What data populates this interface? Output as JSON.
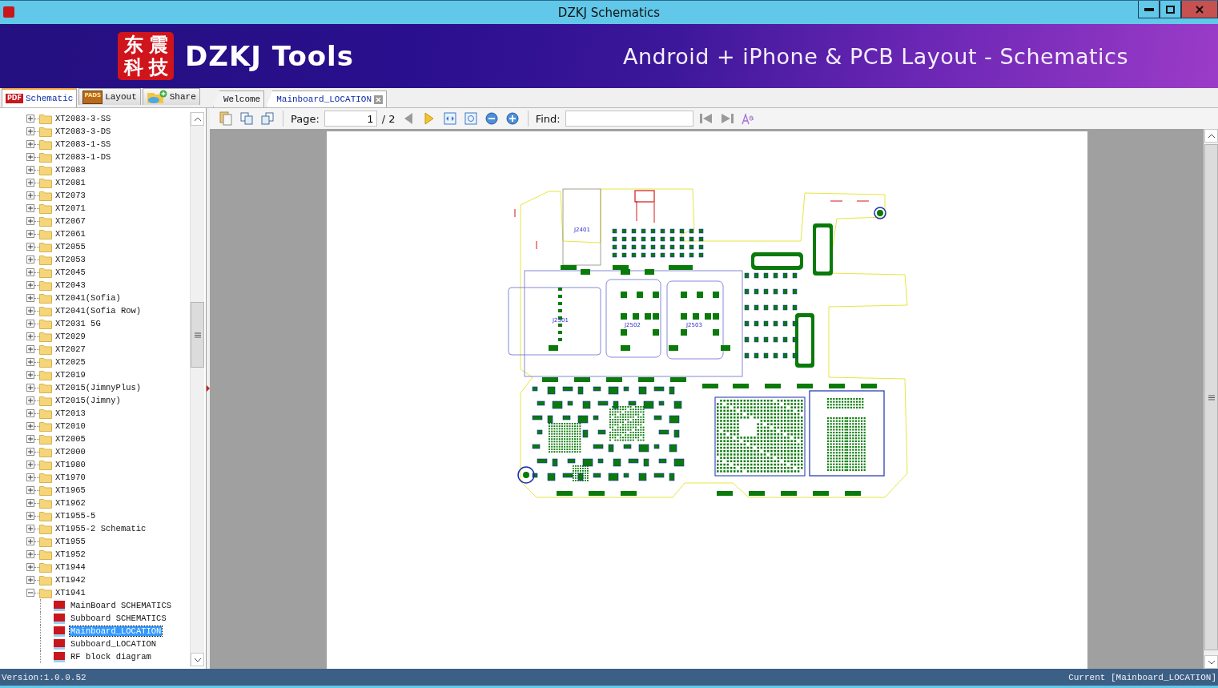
{
  "window": {
    "title": "DZKJ Schematics"
  },
  "banner": {
    "logo_chars": [
      "东",
      "震",
      "科",
      "技"
    ],
    "title": "DZKJ Tools",
    "tagline": "Android + iPhone & PCB Layout - Schematics"
  },
  "side_tabs": [
    {
      "label": "Schematic",
      "kind": "pdf",
      "icon_text": "PDF",
      "selected": true
    },
    {
      "label": "Layout",
      "kind": "pads",
      "icon_text": "PADS",
      "selected": false
    },
    {
      "label": "Share",
      "kind": "share",
      "selected": false
    }
  ],
  "doc_tabs": [
    {
      "label": "Welcome",
      "selected": false,
      "closable": false
    },
    {
      "label": "Mainboard_LOCATION",
      "selected": true,
      "closable": true
    }
  ],
  "toolbar": {
    "page_label": "Page:",
    "page": "1",
    "page_total": "/ 2",
    "find_label": "Find:"
  },
  "tree": [
    {
      "label": "XT2083-3-SS",
      "expanded": false
    },
    {
      "label": "XT2083-3-DS",
      "expanded": false
    },
    {
      "label": "XT2083-1-SS",
      "expanded": false
    },
    {
      "label": "XT2083-1-DS",
      "expanded": false
    },
    {
      "label": "XT2083",
      "expanded": false
    },
    {
      "label": "XT2081",
      "expanded": false
    },
    {
      "label": "XT2073",
      "expanded": false
    },
    {
      "label": "XT2071",
      "expanded": false
    },
    {
      "label": "XT2067",
      "expanded": false
    },
    {
      "label": "XT2061",
      "expanded": false
    },
    {
      "label": "XT2055",
      "expanded": false
    },
    {
      "label": "XT2053",
      "expanded": false
    },
    {
      "label": "XT2045",
      "expanded": false
    },
    {
      "label": "XT2043",
      "expanded": false
    },
    {
      "label": "XT2041(Sofia)",
      "expanded": false
    },
    {
      "label": "XT2041(Sofia Row)",
      "expanded": false
    },
    {
      "label": "XT2031 5G",
      "expanded": false
    },
    {
      "label": "XT2029",
      "expanded": false
    },
    {
      "label": "XT2027",
      "expanded": false
    },
    {
      "label": "XT2025",
      "expanded": false
    },
    {
      "label": "XT2019",
      "expanded": false
    },
    {
      "label": "XT2015(JimnyPlus)",
      "expanded": false
    },
    {
      "label": "XT2015(Jimny)",
      "expanded": false
    },
    {
      "label": "XT2013",
      "expanded": false
    },
    {
      "label": "XT2010",
      "expanded": false
    },
    {
      "label": "XT2005",
      "expanded": false
    },
    {
      "label": "XT2000",
      "expanded": false
    },
    {
      "label": "XT1980",
      "expanded": false
    },
    {
      "label": "XT1970",
      "expanded": false
    },
    {
      "label": "XT1965",
      "expanded": false
    },
    {
      "label": "XT1962",
      "expanded": false
    },
    {
      "label": "XT1955-5",
      "expanded": false
    },
    {
      "label": "XT1955-2 Schematic",
      "expanded": false
    },
    {
      "label": "XT1955",
      "expanded": false
    },
    {
      "label": "XT1952",
      "expanded": false
    },
    {
      "label": "XT1944",
      "expanded": false
    },
    {
      "label": "XT1942",
      "expanded": false
    },
    {
      "label": "XT1941",
      "expanded": true,
      "children": [
        {
          "label": "MainBoard SCHEMATICS",
          "selected": false
        },
        {
          "label": "Subboard SCHEMATICS",
          "selected": false
        },
        {
          "label": "Mainboard_LOCATION",
          "selected": true
        },
        {
          "label": "Subboard_LOCATION",
          "selected": false
        },
        {
          "label": "RF block diagram",
          "selected": false
        }
      ]
    }
  ],
  "document": {
    "labels": [
      "J2401",
      "J2501",
      "J2502",
      "J2503"
    ]
  },
  "status_bar": {
    "version": "Version:1.0.0.52",
    "current": "Current [Mainboard_LOCATION]"
  }
}
